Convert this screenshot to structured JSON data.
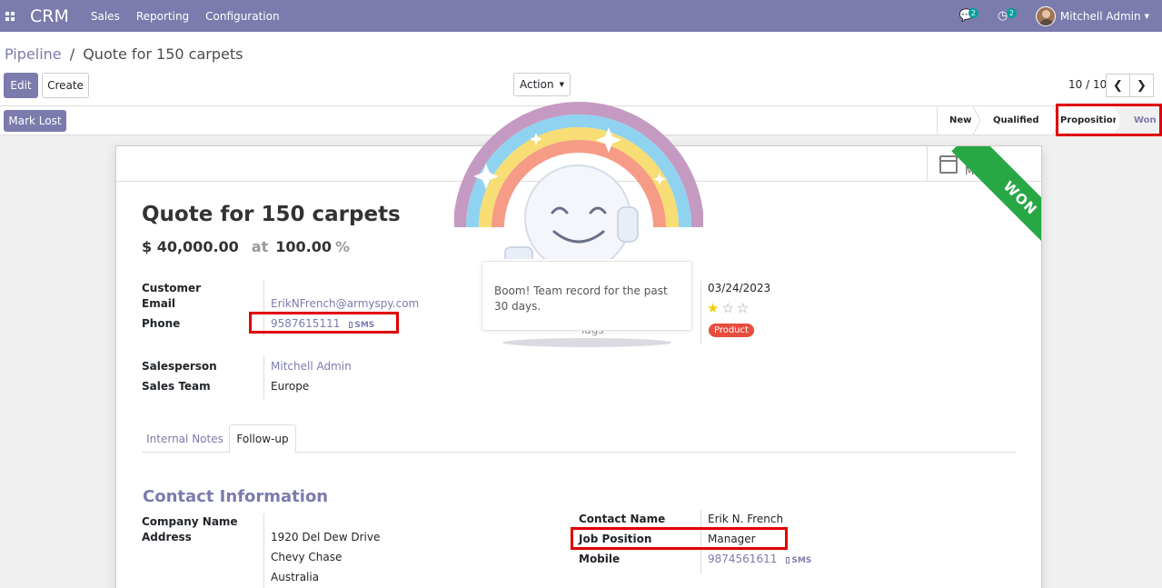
{
  "navbar": {
    "apps_icon": "apps-grid-icon",
    "brand": "CRM",
    "menu": [
      "Sales",
      "Reporting",
      "Configuration"
    ],
    "messages_badge": "2",
    "activities_badge": "2",
    "user_name": "Mitchell Admin"
  },
  "control": {
    "breadcrumb_parent": "Pipeline",
    "breadcrumb_sep": "/",
    "breadcrumb_current": "Quote for 150 carpets",
    "edit_label": "Edit",
    "create_label": "Create",
    "action_label": "Action",
    "pager": "10 / 10"
  },
  "statusbar": {
    "mark_lost_label": "Mark Lost",
    "stages": [
      "New",
      "Qualified",
      "Proposition",
      "Won"
    ],
    "current_stage": "Won"
  },
  "record": {
    "meeting_count": "0",
    "meeting_label": "Meeting",
    "ribbon": "WON",
    "title": "Quote for 150 carpets",
    "expected_revenue": "$ 40,000.00",
    "at_label": "at",
    "probability": "100.00",
    "probability_unit": "%",
    "customer_label": "Customer",
    "email_label": "Email",
    "email": "ErikNFrench@armyspy.com",
    "phone_label": "Phone",
    "phone": "9587615111",
    "sms_label": "SMS",
    "salesperson_label": "Salesperson",
    "salesperson": "Mitchell Admin",
    "sales_team_label": "Sales Team",
    "sales_team": "Europe",
    "deadline": "03/24/2023",
    "priority": {
      "filled": 1,
      "total": 3
    },
    "tags_label": "Tags",
    "tag": "Product",
    "tags": {
      "product_color": "#e74c3c"
    }
  },
  "tabs": [
    "Internal Notes",
    "Follow-up"
  ],
  "active_tab": "Follow-up",
  "contact": {
    "section_title": "Contact Information",
    "company_name_label": "Company Name",
    "address_label": "Address",
    "address_line1": "1920 Del Dew Drive",
    "address_line2": "Chevy Chase",
    "address_line3": "Australia",
    "contact_name_label": "Contact Name",
    "contact_name": "Erik N. French",
    "job_position_label": "Job Position",
    "job_position": "Manager",
    "mobile_label": "Mobile",
    "mobile": "9874561611",
    "sms_label": "SMS"
  },
  "rainbow_man": {
    "message": "Boom! Team record for the past 30 days."
  },
  "colors": {
    "brand": "#7c7bad",
    "won_ribbon": "#28a745",
    "highlight": "#e00000"
  }
}
